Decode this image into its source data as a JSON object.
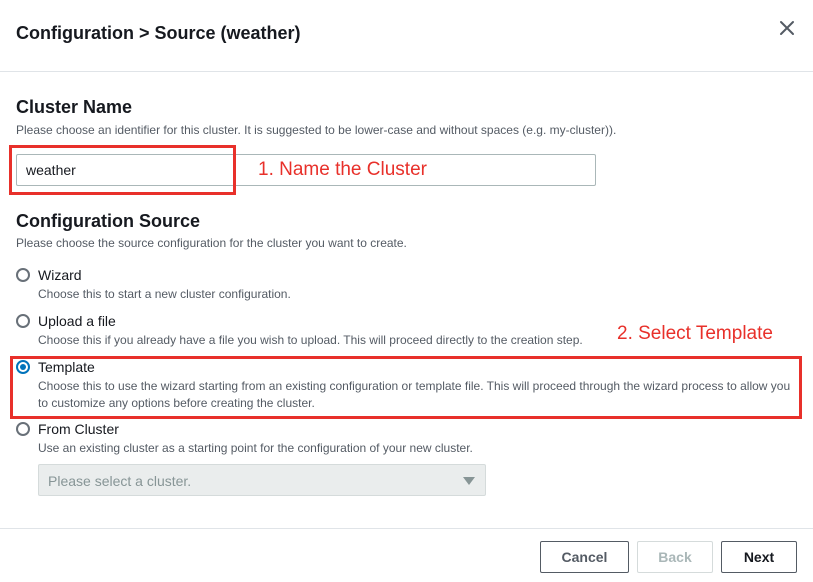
{
  "dialog": {
    "title": "Configuration > Source (weather)"
  },
  "cluster_name": {
    "heading": "Cluster Name",
    "description": "Please choose an identifier for this cluster. It is suggested to be lower-case and without spaces (e.g. my-cluster)).",
    "value": "weather"
  },
  "config_source": {
    "heading": "Configuration Source",
    "description": "Please choose the source configuration for the cluster you want to create.",
    "options": [
      {
        "label": "Wizard",
        "description": "Choose this to start a new cluster configuration.",
        "selected": false
      },
      {
        "label": "Upload a file",
        "description": "Choose this if you already have a file you wish to upload. This will proceed directly to the creation step.",
        "selected": false
      },
      {
        "label": "Template",
        "description": "Choose this to use the wizard starting from an existing configuration or template file. This will proceed through the wizard process to allow you to customize any options before creating the cluster.",
        "selected": true
      },
      {
        "label": "From Cluster",
        "description": "Use an existing cluster as a starting point for the configuration of your new cluster.",
        "selected": false
      }
    ],
    "cluster_select": {
      "placeholder": "Please select a cluster."
    }
  },
  "annotations": {
    "step1": "1. Name the Cluster",
    "step2": "2. Select Template"
  },
  "footer": {
    "cancel": "Cancel",
    "back": "Back",
    "next": "Next"
  },
  "colors": {
    "accent": "#0073bb",
    "annotation": "#e8302a"
  }
}
